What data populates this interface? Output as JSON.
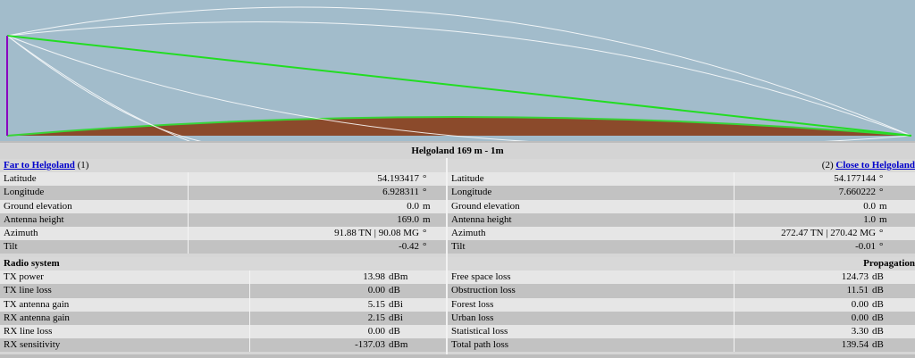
{
  "profile": {
    "sky_color": "#a2bccb",
    "ground_color": "#8b4a2b",
    "ground_edge": "#38d438",
    "los_color": "#22dd22",
    "fresnel_color": "#ffffff",
    "mast_color": "#8a00c0"
  },
  "title": "Helgoland 169 m - 1m",
  "left": {
    "link": "Far to Helgoland",
    "num": "(1)",
    "rows": [
      {
        "label": "Latitude",
        "value": "54.193417",
        "unit": "°"
      },
      {
        "label": "Longitude",
        "value": "6.928311",
        "unit": "°"
      },
      {
        "label": "Ground elevation",
        "value": "0.0",
        "unit": "m"
      },
      {
        "label": "Antenna height",
        "value": "169.0",
        "unit": "m"
      },
      {
        "label": "Azimuth",
        "value": "91.88 TN | 90.08 MG",
        "unit": "°"
      },
      {
        "label": "Tilt",
        "value": "-0.42",
        "unit": "°"
      }
    ]
  },
  "right": {
    "link": "Close to Helgoland",
    "num": "(2)",
    "rows": [
      {
        "label": "Latitude",
        "value": "54.177144",
        "unit": "°"
      },
      {
        "label": "Longitude",
        "value": "7.660222",
        "unit": "°"
      },
      {
        "label": "Ground elevation",
        "value": "0.0",
        "unit": "m"
      },
      {
        "label": "Antenna height",
        "value": "1.0",
        "unit": "m"
      },
      {
        "label": "Azimuth",
        "value": "272.47 TN | 270.42 MG",
        "unit": "°"
      },
      {
        "label": "Tilt",
        "value": "-0.01",
        "unit": "°"
      }
    ]
  },
  "radio": {
    "header": "Radio system",
    "rows": [
      {
        "label": "TX power",
        "value": "13.98",
        "unit": "dBm"
      },
      {
        "label": "TX line loss",
        "value": "0.00",
        "unit": "dB"
      },
      {
        "label": "TX antenna gain",
        "value": "5.15",
        "unit": "dBi"
      },
      {
        "label": "RX antenna gain",
        "value": "2.15",
        "unit": "dBi"
      },
      {
        "label": "RX line loss",
        "value": "0.00",
        "unit": "dB"
      },
      {
        "label": "RX sensitivity",
        "value": "-137.03",
        "unit": "dBm"
      }
    ]
  },
  "propagation": {
    "header": "Propagation",
    "rows": [
      {
        "label": "Free space loss",
        "value": "124.73",
        "unit": "dB"
      },
      {
        "label": "Obstruction loss",
        "value": "11.51",
        "unit": "dB"
      },
      {
        "label": "Forest loss",
        "value": "0.00",
        "unit": "dB"
      },
      {
        "label": "Urban loss",
        "value": "0.00",
        "unit": "dB"
      },
      {
        "label": "Statistical loss",
        "value": "3.30",
        "unit": "dB"
      },
      {
        "label": "Total path loss",
        "value": "139.54",
        "unit": "dB"
      }
    ]
  }
}
